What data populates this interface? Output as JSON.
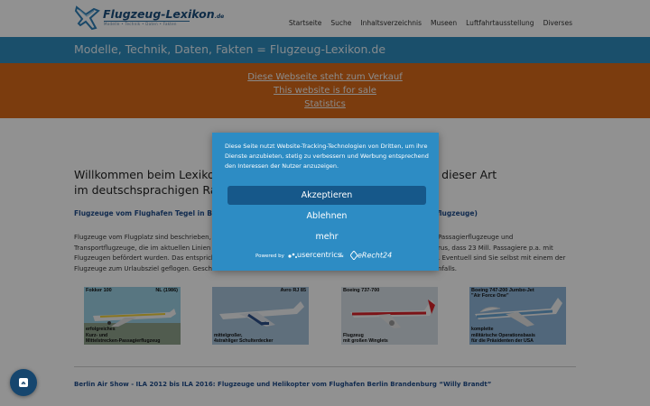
{
  "header": {
    "logo_text": "Flugzeug-Lexikon",
    "logo_suffix": ".de",
    "logo_tagline": "Modelle • Technik • Daten • Fakten"
  },
  "nav": {
    "items": [
      {
        "label": "Startseite"
      },
      {
        "label": "Suche"
      },
      {
        "label": "Inhaltsverzeichnis"
      },
      {
        "label": "Museen"
      },
      {
        "label": "Luftfahrtausstellung"
      },
      {
        "label": "Diverses"
      }
    ]
  },
  "banner": {
    "title": "Modelle, Technik, Daten, Fakten = Flugzeug-Lexikon.de"
  },
  "sale": {
    "line1": "Diese Webseite steht zum Verkauf",
    "line2": "This website is for sale",
    "line3": "Statistics"
  },
  "main": {
    "welcome_part1": "Willkommen beim Lexikon",
    "welcome_part2": "lugzeuglexikon dieser Art",
    "welcome_line2": "im deutschsprachigen Ra",
    "sub1_left": "Flugzeuge vom Flughafen Tegel in Berl",
    "sub1_right": "flugzeuge)",
    "para_lines_left": [
      "Flugzeuge vom Flugplatz sind beschrieben,",
      "Transportflugzeuge, die im aktuellen Linien",
      "Flugzeugen befördert wurden. Das entsprich",
      "Flugzeuge zum Urlaubsziel geflogen. Gesch"
    ],
    "para_lines_right": [
      "Passagierflugzeuge und",
      "rus, dass 23 Mill. Passagiere p.a. mit",
      ". Eventuell sind Sie selbst mit einem der",
      "nfalls."
    ],
    "sub2": "Berlin Air Show - ILA 2012 bis ILA 2016: Flugzeuge und Helikopter vom Flughafen Berlin Brandenburg “Willy Brandt”"
  },
  "tiles": [
    {
      "top_left": "Fokker 100",
      "top_right": "NL (1986)",
      "bottom": [
        "erfolgreiches",
        "Kurz- und",
        "Mittelstrecken-Passagierflugzeug"
      ],
      "bg": "#9bd0e3",
      "accent": "#f0d03a"
    },
    {
      "top_left": "",
      "top_right": "Avro RJ 85",
      "bottom": [
        "mittelgroßer,",
        "4strahliger Schulterdecker"
      ],
      "bg": "#a7c3da",
      "accent": "#ffffff"
    },
    {
      "top_left": "Boeing 737-700",
      "top_right": "",
      "bottom": [
        "Flugzeug",
        "mit großen Winglets"
      ],
      "bg": "#d6dfe7",
      "accent": "#d8232a"
    },
    {
      "top_left": "Boeing 747-200 Jumbo-Jet",
      "top_right": "",
      "top_left2": "\"Air Force One\"",
      "bottom": [
        "komplette",
        "militärische Operationsbasis",
        "für die Präsidenten der USA"
      ],
      "bg": "#8fb6d8",
      "accent": "#ffffff"
    }
  ],
  "consent": {
    "text": "Diese Seite nutzt Website-Tracking-Technologien von Dritten, um ihre Dienste anzubieten, stetig zu verbessern und Werbung entsprechend den Interessen der Nutzer anzuzeigen.",
    "accept_label": "Akzeptieren",
    "deny_label": "Ablehnen",
    "more_label": "mehr",
    "powered_by": "Powered by",
    "usercentrics": "usercentrics",
    "amp": "&",
    "erecht": "eRecht24"
  },
  "colors": {
    "banner": "#2f8bbd",
    "sale": "#d86a1a",
    "consent_bg": "#2d8cc4",
    "accept_btn": "#16588a"
  },
  "icons": {
    "logo": "plane-logo-icon",
    "cookie": "fingerprint-icon"
  }
}
